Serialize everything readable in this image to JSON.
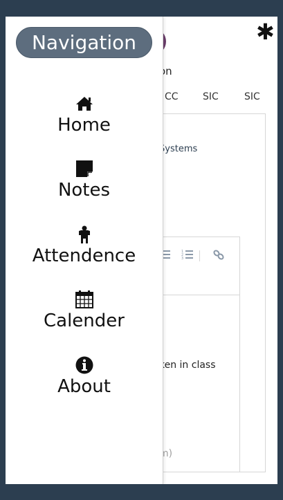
{
  "drawer": {
    "title": "Navigation",
    "items": [
      {
        "label": "Home",
        "icon": "home-icon"
      },
      {
        "label": "Notes",
        "icon": "note-icon"
      },
      {
        "label": "Attendence",
        "icon": "child-icon"
      },
      {
        "label": "Calender",
        "icon": "calendar-icon"
      },
      {
        "label": "About",
        "icon": "info-icon"
      }
    ]
  },
  "background": {
    "menu_icon": "asterisk-icon",
    "subtitle_fragment": "on",
    "tabs": [
      "CC",
      "SIC",
      "SIC"
    ],
    "card_title_fragment": "Systems",
    "editor_text_fragment": "ken in class",
    "editor_placeholder_fragment": "m)"
  },
  "colors": {
    "page_background": "#2c3e50",
    "pill_background": "#5d6d7e",
    "avatar": "#6b3e6b",
    "toolbar_icon": "#8a98a8"
  }
}
